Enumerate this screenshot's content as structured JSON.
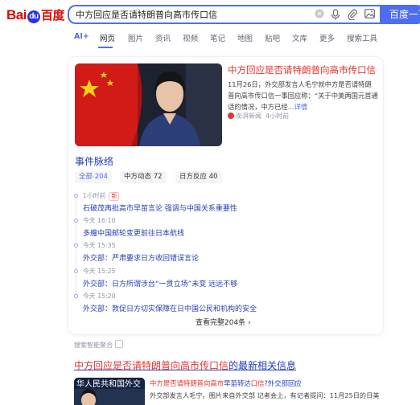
{
  "header": {
    "logo": {
      "bai": "Bai",
      "du": "du",
      "cn": "百度"
    },
    "search_value": "中方回应是否请特朗普向高市传口信",
    "search_button": "百度一下"
  },
  "tabs": [
    {
      "label": "AI+"
    },
    {
      "label": "网页"
    },
    {
      "label": "图片"
    },
    {
      "label": "资讯"
    },
    {
      "label": "视频"
    },
    {
      "label": "笔记"
    },
    {
      "label": "地图"
    },
    {
      "label": "贴吧"
    },
    {
      "label": "文库"
    },
    {
      "label": "更多"
    },
    {
      "label": "搜索工具"
    }
  ],
  "news": {
    "title": "中方回应是否请特朗普向高市传口信",
    "body": "11月26日，外交部发言人毛宁就中方是否请特朗普向高市传口信一事回应称：“关于中美两国元首通话的情况，中方已经...",
    "more": "详情",
    "source": "澎湃新闻",
    "time": "4小时前"
  },
  "events": {
    "title": "事件脉络",
    "chips": [
      {
        "label": "全部 204"
      },
      {
        "label": "中方动态 72"
      },
      {
        "label": "日方反应 40"
      }
    ],
    "items": [
      {
        "time": "1小时前",
        "badge": "新",
        "text": "石破茂再批高市早苗言论 强调与中国关系重要性"
      },
      {
        "time": "今天 16:10",
        "text": "多艘中国邮轮变更前往日本航线"
      },
      {
        "time": "今天 15:35",
        "text": "外交部：严肃要求日方收回错误言论"
      },
      {
        "time": "今天 15:25",
        "text": "外交部：日方所谓涉台“一贯立场”未变 远远不够"
      },
      {
        "time": "今天 15:20",
        "text": "外交部：敦促日方切实保障在日中国公民和机构的安全"
      }
    ],
    "view_all": "查看完整204条"
  },
  "aggregation_label": "搜索智能聚合",
  "result2": {
    "title_hl": "中方回应是否请特朗普向高市传口信",
    "title_rest": "的最新相关信息",
    "sub_hl": "中方是否请特朗普向高市",
    "sub_n": "早苗转达",
    "sub_hl2": "口信",
    "sub_rest": "?外交部回应",
    "body": "外交部发言人毛宁。图片来自外交部 记者会上，有记者提问：11月25日的日美",
    "img_text": "华人民共和国外交"
  }
}
